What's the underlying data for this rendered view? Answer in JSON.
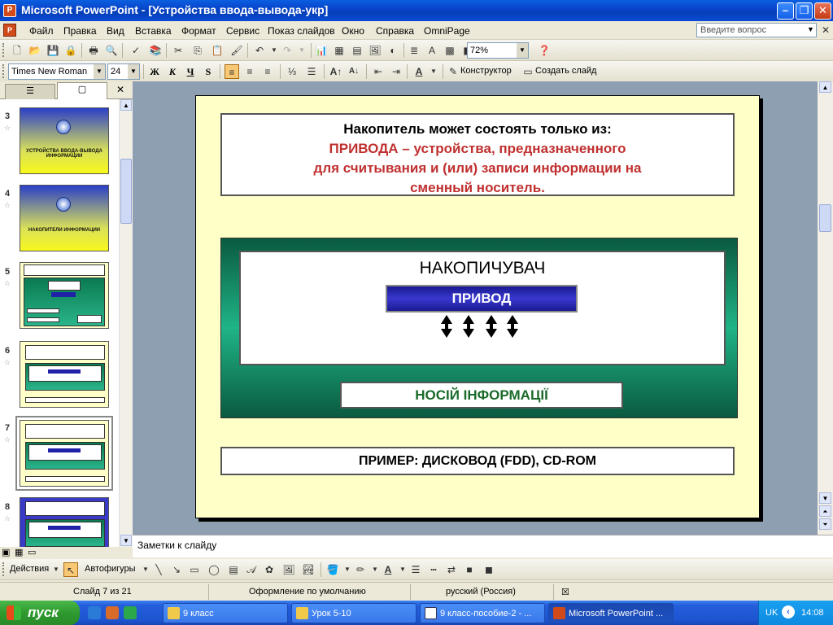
{
  "window": {
    "title": "Microsoft PowerPoint - [Устройства ввода-вывода-укр]"
  },
  "menu": {
    "items": [
      "Файл",
      "Правка",
      "Вид",
      "Вставка",
      "Формат",
      "Сервис",
      "Показ слайдов",
      "Окно",
      "Справка",
      "OmniPage"
    ],
    "ask_placeholder": "Введите вопрос"
  },
  "standard_toolbar": {
    "zoom": "72%"
  },
  "format_toolbar": {
    "font": "Times New Roman",
    "size": "24",
    "bold": "Ж",
    "italic": "К",
    "underline": "Ч",
    "shadow": "S",
    "designer": "Конструктор",
    "new_slide": "Создать слайд"
  },
  "thumbnails": [
    {
      "num": "3",
      "caption": "УСТРОЙСТВА ВВОДА-ВЫВОДА ИНФОРМАЦИИ"
    },
    {
      "num": "4",
      "caption": "НАКОПИТЕЛИ ИНФОРМАЦИИ"
    },
    {
      "num": "5"
    },
    {
      "num": "6"
    },
    {
      "num": "7"
    },
    {
      "num": "8"
    }
  ],
  "slide": {
    "top_line1": "Накопитель может состоять только из:",
    "top_red_bold": "ПРИВОДА",
    "top_red_rest": " – устройства, предназначенного",
    "top_line3": "для считывания и (или) записи информации на",
    "top_line4": "сменный носитель.",
    "storage_title": "НАКОПИЧУВАЧ",
    "drive_label": "ПРИВОД",
    "medium_label": "НОСІЙ ІНФОРМАЦІЇ",
    "example": "ПРИМЕР: ДИСКОВОД (FDD), CD-ROM"
  },
  "notes": {
    "placeholder": "Заметки к слайду"
  },
  "drawing_toolbar": {
    "actions": "Действия",
    "autoshapes": "Автофигуры"
  },
  "status": {
    "slide": "Слайд 7 из 21",
    "design": "Оформление по умолчанию",
    "language": "русский (Россия)"
  },
  "taskbar": {
    "start": "пуск",
    "tasks": [
      "9 класс",
      "Урок  5-10",
      "9 класс-пособие-2 - ...",
      "Microsoft PowerPoint ..."
    ],
    "lang": "UK",
    "time": "14:08"
  }
}
